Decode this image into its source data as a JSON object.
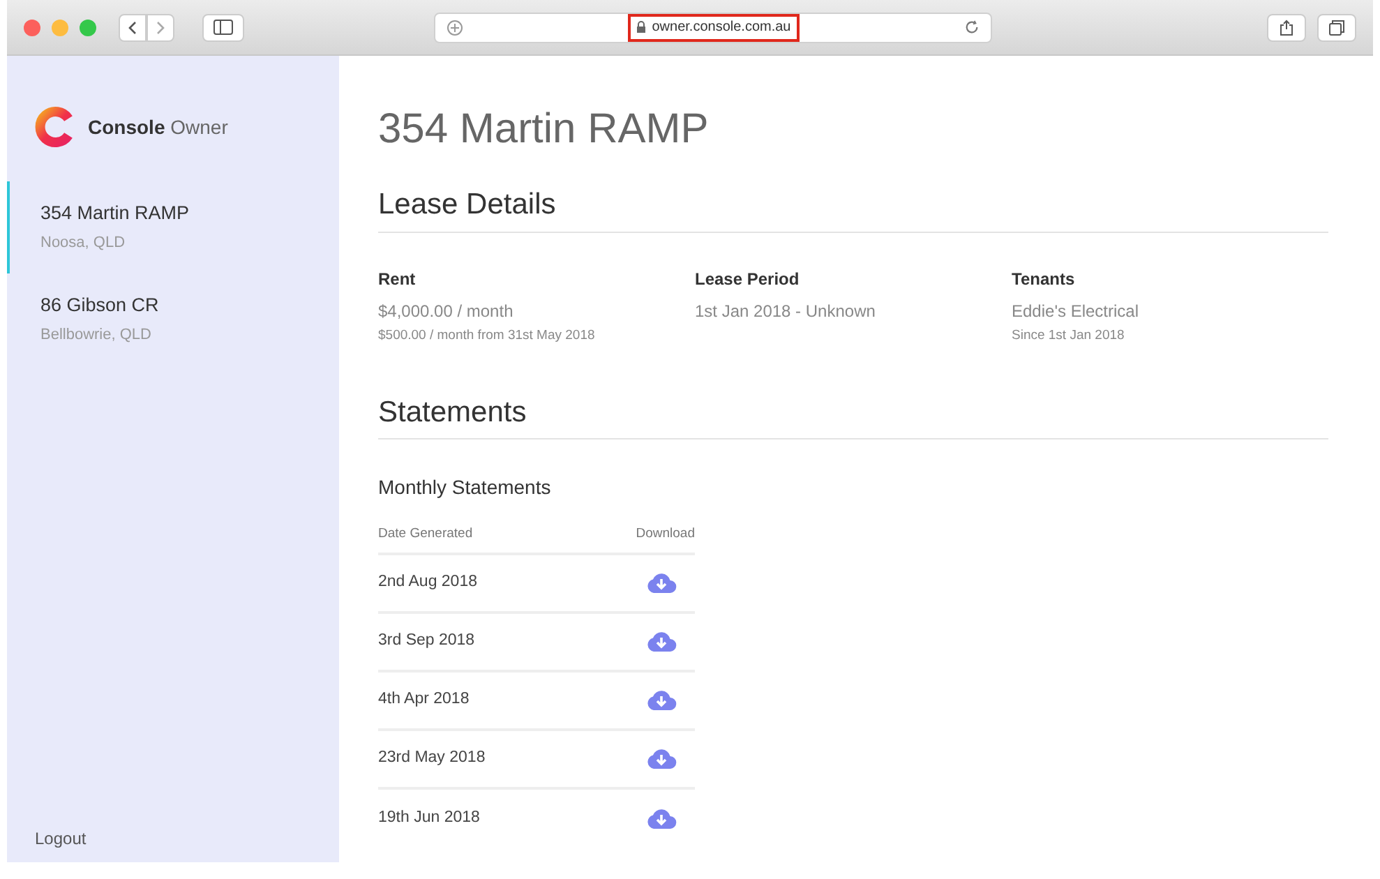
{
  "browser": {
    "url": "owner.console.com.au"
  },
  "sidebar": {
    "brand": {
      "bold": "Console",
      "light": "Owner"
    },
    "items": [
      {
        "title": "354 Martin RAMP",
        "subtitle": "Noosa, QLD",
        "selected": true
      },
      {
        "title": "86 Gibson CR",
        "subtitle": "Bellbowrie, QLD",
        "selected": false
      }
    ],
    "logout": "Logout"
  },
  "page_title": "354 Martin RAMP",
  "lease_details": {
    "heading": "Lease Details",
    "fields": [
      {
        "label": "Rent",
        "value": "$4,000.00 / month",
        "note": "$500.00 / month from 31st May 2018"
      },
      {
        "label": "Lease Period",
        "value": "1st Jan 2018 - Unknown"
      },
      {
        "label": "Tenants",
        "value": "Eddie's Electrical",
        "note": "Since 1st Jan 2018"
      }
    ]
  },
  "statements": {
    "heading": "Statements",
    "subheading": "Monthly Statements",
    "columns": [
      "Date Generated",
      "Download"
    ],
    "rows": [
      "2nd Aug 2018",
      "3rd Sep 2018",
      "4th Apr 2018",
      "23rd May 2018",
      "19th Jun 2018"
    ]
  }
}
